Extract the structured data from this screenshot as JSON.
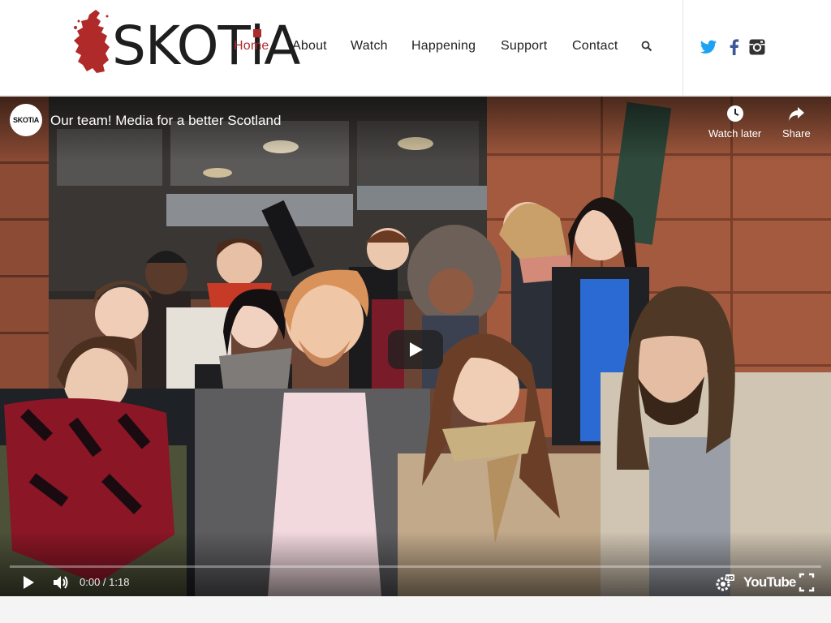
{
  "brand": {
    "logo_text_before": "SKOT",
    "logo_text_i": "i",
    "logo_text_after": "A",
    "accent_color": "#b02a2a"
  },
  "nav": {
    "items": [
      {
        "label": "Home",
        "active": true
      },
      {
        "label": "About",
        "active": false
      },
      {
        "label": "Watch",
        "active": false
      },
      {
        "label": "Happening",
        "active": false
      },
      {
        "label": "Support",
        "active": false
      },
      {
        "label": "Contact",
        "active": false
      }
    ],
    "search_icon": "search-icon"
  },
  "social": [
    {
      "name": "twitter-icon",
      "color": "#1da1f2"
    },
    {
      "name": "facebook-icon",
      "color": "#3b5998"
    },
    {
      "name": "instagram-icon",
      "color": "#333333"
    }
  ],
  "video": {
    "channel_avatar_text": "SKOTiA",
    "title": "Our team! Media for a better Scotland",
    "watch_later_label": "Watch later",
    "share_label": "Share",
    "current_time": "0:00",
    "duration": "1:18",
    "time_display": "0:00 / 1:18",
    "progress": 0,
    "platform_label": "YouTube",
    "settings_badge": "HD"
  }
}
